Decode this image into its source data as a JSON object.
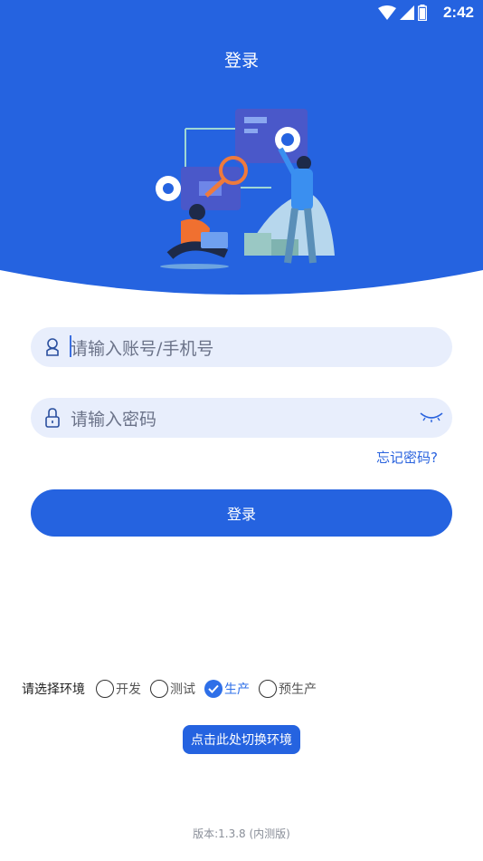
{
  "status_bar": {
    "time": "2:42"
  },
  "header": {
    "title": "登录"
  },
  "login_form": {
    "account_placeholder": "请输入账号/手机号",
    "password_placeholder": "请输入密码",
    "forgot_password": "忘记密码?",
    "submit_label": "登录"
  },
  "environment": {
    "label": "请选择环境",
    "options": [
      {
        "label": "开发",
        "selected": false
      },
      {
        "label": "测试",
        "selected": false
      },
      {
        "label": "生产",
        "selected": true
      },
      {
        "label": "预生产",
        "selected": false
      }
    ],
    "switch_button": "点击此处切换环境"
  },
  "footer": {
    "version": "版本:1.3.8 (内测版)"
  },
  "colors": {
    "primary": "#2563e0",
    "input_bg": "#e8eefc",
    "link": "#2a63de"
  },
  "icons": [
    "wifi-icon",
    "signal-icon",
    "battery-icon",
    "user-icon",
    "lock-icon",
    "eye-closed-icon",
    "check-icon"
  ]
}
